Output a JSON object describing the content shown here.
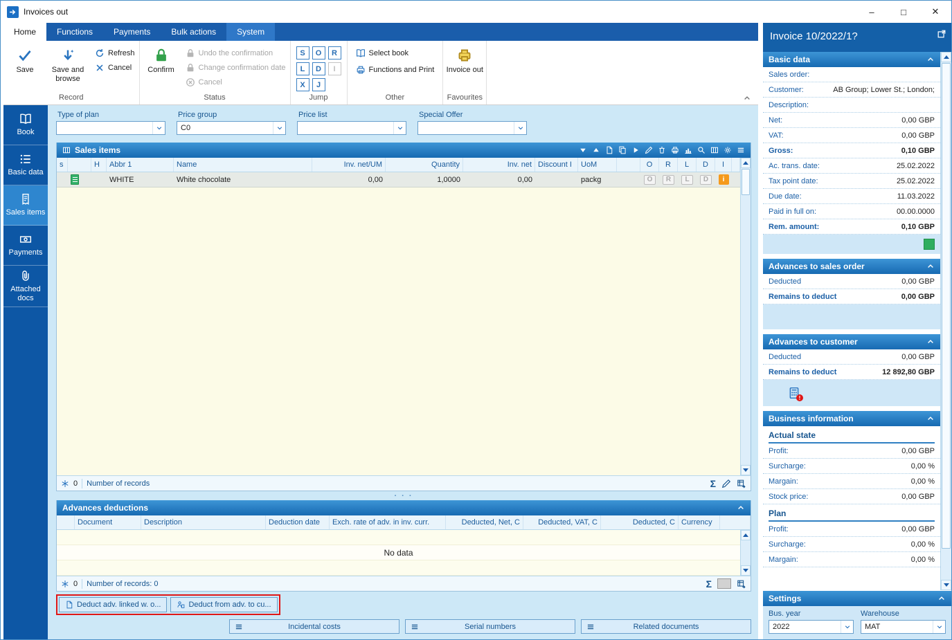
{
  "window": {
    "title": "Invoices out"
  },
  "glyphs": {
    "sigma": "Σ",
    "dots": "· · ·",
    "minimize": "–",
    "maximize": "□",
    "close": "✕"
  },
  "tabs": [
    {
      "label": "Home"
    },
    {
      "label": "Functions"
    },
    {
      "label": "Payments"
    },
    {
      "label": "Bulk actions"
    },
    {
      "label": "System"
    }
  ],
  "ribbon": {
    "record": {
      "label": "Record",
      "save": "Save",
      "save_and_browse": "Save and browse",
      "refresh": "Refresh",
      "cancel": "Cancel"
    },
    "status": {
      "label": "Status",
      "confirm": "Confirm",
      "undo": "Undo the confirmation",
      "change_date": "Change confirmation date",
      "cancel": "Cancel"
    },
    "jump": {
      "label": "Jump",
      "keys": [
        "S",
        "O",
        "R",
        "L",
        "D",
        "I",
        "X",
        "J"
      ]
    },
    "other": {
      "label": "Other",
      "select_book": "Select book",
      "functions_print": "Functions and Print"
    },
    "favourites": {
      "label": "Favourites",
      "invoice_out": "Invoice out"
    }
  },
  "sidebar": {
    "items": [
      {
        "label": "Book"
      },
      {
        "label": "Basic data"
      },
      {
        "label": "Sales items"
      },
      {
        "label": "Payments"
      },
      {
        "label": "Attached docs"
      }
    ]
  },
  "filters": [
    {
      "label": "Type of plan",
      "value": ""
    },
    {
      "label": "Price group",
      "value": "C0"
    },
    {
      "label": "Price list",
      "value": ""
    },
    {
      "label": "Special Offer",
      "value": ""
    }
  ],
  "sales_items": {
    "title": "Sales items",
    "columns": {
      "s": "s",
      "h": "H",
      "abbr": "Abbr 1",
      "name": "Name",
      "inv_net_um": "Inv. net/UM",
      "quantity": "Quantity",
      "inv_net": "Inv. net",
      "discount": "Discount I",
      "uom": "UoM",
      "o": "O",
      "r": "R",
      "l": "L",
      "d": "D",
      "i": "I"
    },
    "rows": [
      {
        "abbr": "WHITE",
        "name": "White chocolate",
        "inv_net_um": "0,00",
        "quantity": "1,0000",
        "inv_net": "0,00",
        "discount": "",
        "uom": "packg",
        "o": "O",
        "r": "R",
        "l": "L",
        "d": "D",
        "i": "i"
      }
    ],
    "footer": {
      "count": "0",
      "records": "Number of records"
    }
  },
  "advances": {
    "title": "Advances deductions",
    "columns": [
      "Document",
      "Description",
      "Deduction date",
      "Exch. rate of adv. in inv. curr.",
      "Deducted, Net, C",
      "Deducted, VAT, C",
      "Deducted, C",
      "Currency"
    ],
    "no_data": "No data",
    "footer": {
      "count": "0",
      "records": "Number of records: 0"
    },
    "buttons": [
      {
        "label": "Deduct adv. linked w. o..."
      },
      {
        "label": "Deduct from adv. to cu..."
      }
    ]
  },
  "bottom_buttons": [
    {
      "label": "Incidental costs"
    },
    {
      "label": "Serial numbers"
    },
    {
      "label": "Related documents"
    }
  ],
  "right": {
    "title": "Invoice 10/2022/1?",
    "basic": {
      "title": "Basic data",
      "fields": [
        {
          "label": "Sales order:",
          "value": ""
        },
        {
          "label": "Customer:",
          "value": "AB Group; Lower St.; London;"
        },
        {
          "label": "Description:",
          "value": ""
        },
        {
          "label": "Net:",
          "value": "0,00 GBP"
        },
        {
          "label": "VAT:",
          "value": "0,00 GBP"
        },
        {
          "label": "Gross:",
          "value": "0,10 GBP"
        },
        {
          "label": "Ac. trans. date:",
          "value": "25.02.2022"
        },
        {
          "label": "Tax point date:",
          "value": "25.02.2022"
        },
        {
          "label": "Due date:",
          "value": "11.03.2022"
        },
        {
          "label": "Paid in full on:",
          "value": "00.00.0000"
        },
        {
          "label": "Rem. amount:",
          "value": "0,10 GBP"
        }
      ]
    },
    "adv_order": {
      "title": "Advances to sales order",
      "fields": [
        {
          "label": "Deducted",
          "value": "0,00 GBP"
        },
        {
          "label": "Remains to deduct",
          "value": "0,00 GBP"
        }
      ]
    },
    "adv_customer": {
      "title": "Advances to customer",
      "fields": [
        {
          "label": "Deducted",
          "value": "0,00 GBP"
        },
        {
          "label": "Remains to deduct",
          "value": "12 892,80 GBP"
        }
      ]
    },
    "business": {
      "title": "Business information",
      "actual": {
        "title": "Actual state",
        "fields": [
          {
            "label": "Profit:",
            "value": "0,00 GBP"
          },
          {
            "label": "Surcharge:",
            "value": "0,00 %"
          },
          {
            "label": "Margain:",
            "value": "0,00 %"
          },
          {
            "label": "Stock price:",
            "value": "0,00 GBP"
          }
        ]
      },
      "plan": {
        "title": "Plan",
        "fields": [
          {
            "label": "Profit:",
            "value": "0,00 GBP"
          },
          {
            "label": "Surcharge:",
            "value": "0,00 %"
          },
          {
            "label": "Margain:",
            "value": "0,00 %"
          }
        ]
      }
    },
    "settings": {
      "title": "Settings",
      "bus_year_label": "Bus. year",
      "bus_year": "2022",
      "warehouse_label": "Warehouse",
      "warehouse": "MAT"
    }
  }
}
